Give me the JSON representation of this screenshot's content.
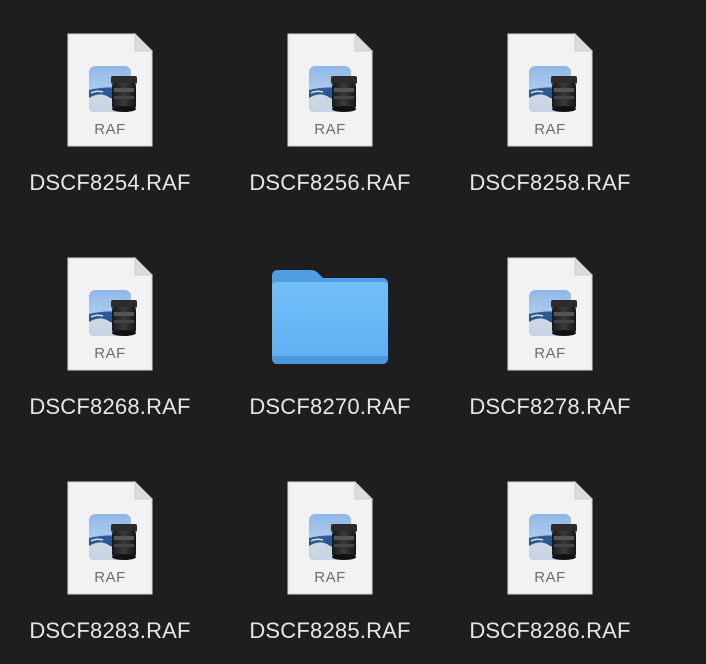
{
  "window": {
    "background": "#1e1e1e"
  },
  "colors": {
    "label": "#e6e6e6",
    "folder_front": "#6ab8f5",
    "folder_back": "#4f9ee3",
    "doc_paper": "#f2f2f2",
    "doc_fold": "#d8d8d8"
  },
  "items": [
    {
      "name": "DSCF8254.RAF",
      "kind": "raw-image",
      "type_label": "RAF",
      "icon": "raw-preview-document-icon"
    },
    {
      "name": "DSCF8256.RAF",
      "kind": "raw-image",
      "type_label": "RAF",
      "icon": "raw-preview-document-icon"
    },
    {
      "name": "DSCF8258.RAF",
      "kind": "raw-image",
      "type_label": "RAF",
      "icon": "raw-preview-document-icon"
    },
    {
      "name": "DSCF8268.RAF",
      "kind": "raw-image",
      "type_label": "RAF",
      "icon": "raw-preview-document-icon"
    },
    {
      "name": "DSCF8270.RAF",
      "kind": "folder",
      "type_label": "",
      "icon": "folder-icon"
    },
    {
      "name": "DSCF8278.RAF",
      "kind": "raw-image",
      "type_label": "RAF",
      "icon": "raw-preview-document-icon"
    },
    {
      "name": "DSCF8283.RAF",
      "kind": "raw-image",
      "type_label": "RAF",
      "icon": "raw-preview-document-icon"
    },
    {
      "name": "DSCF8285.RAF",
      "kind": "raw-image",
      "type_label": "RAF",
      "icon": "raw-preview-document-icon"
    },
    {
      "name": "DSCF8286.RAF",
      "kind": "raw-image",
      "type_label": "RAF",
      "icon": "raw-preview-document-icon"
    }
  ]
}
